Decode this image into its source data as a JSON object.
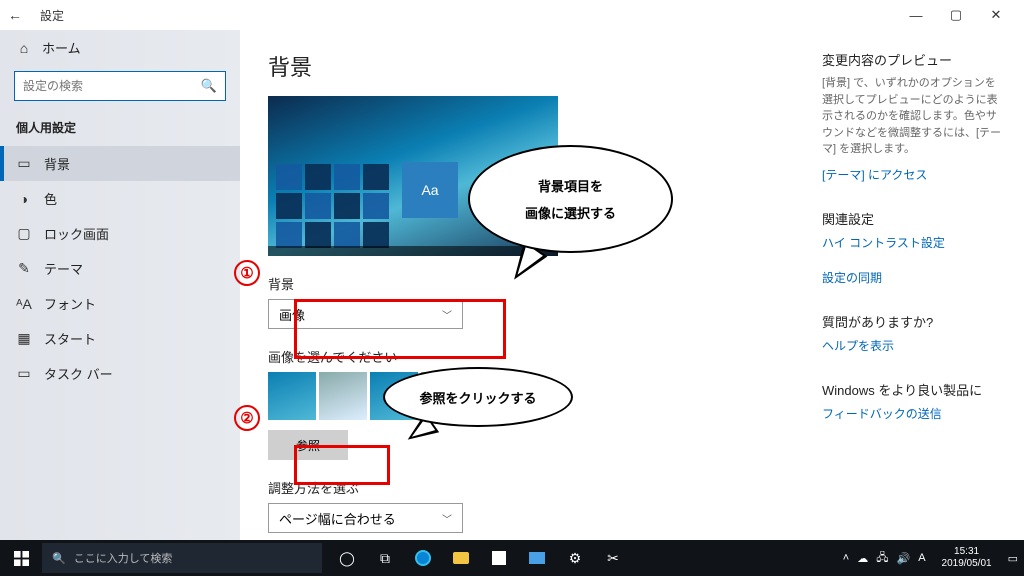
{
  "titlebar": {
    "back": "←",
    "title": "設定"
  },
  "home": {
    "icon": "⌂",
    "label": "ホーム"
  },
  "search": {
    "placeholder": "設定の検索",
    "icon": "🔍"
  },
  "section": "個人用設定",
  "nav": [
    {
      "icon": "▭",
      "label": "背景"
    },
    {
      "icon": "◑",
      "label": "色"
    },
    {
      "icon": "▢",
      "label": "ロック画面"
    },
    {
      "icon": "✎",
      "label": "テーマ"
    },
    {
      "icon": "ᴬA",
      "label": "フォント"
    },
    {
      "icon": "▦",
      "label": "スタート"
    },
    {
      "icon": "▭",
      "label": "タスク バー"
    }
  ],
  "page": {
    "title": "背景",
    "bg_label": "背景",
    "bg_value": "画像",
    "choose_label": "画像を選んでください",
    "browse": "参照",
    "fit_label": "調整方法を選ぶ",
    "fit_value": "ページ幅に合わせる",
    "aa": "Aa"
  },
  "annot": {
    "n1": "①",
    "n2": "②",
    "bubble1_l1": "背景項目を",
    "bubble1_l2": "画像に選択する",
    "bubble2": "参照をクリックする"
  },
  "right": {
    "preview_h": "変更内容のプレビュー",
    "preview_p": "[背景] で、いずれかのオプションを選択してプレビューにどのように表示されるのかを確認します。色やサウンドなどを微調整するには、[テーマ] を選択します。",
    "preview_link": "[テーマ] にアクセス",
    "related_h": "関連設定",
    "related_l1": "ハイ コントラスト設定",
    "related_l2": "設定の同期",
    "q_h": "質問がありますか?",
    "q_link": "ヘルプを表示",
    "better_h": "Windows をより良い製品に",
    "better_link": "フィードバックの送信"
  },
  "taskbar": {
    "search_placeholder": "ここに入力して検索",
    "tray_caret": "˄",
    "tray_ime": "A",
    "time": "15:31",
    "date": "2019/05/01",
    "cortana": "◯"
  },
  "winbtn": {
    "min": "—",
    "max": "▢",
    "close": "✕"
  }
}
